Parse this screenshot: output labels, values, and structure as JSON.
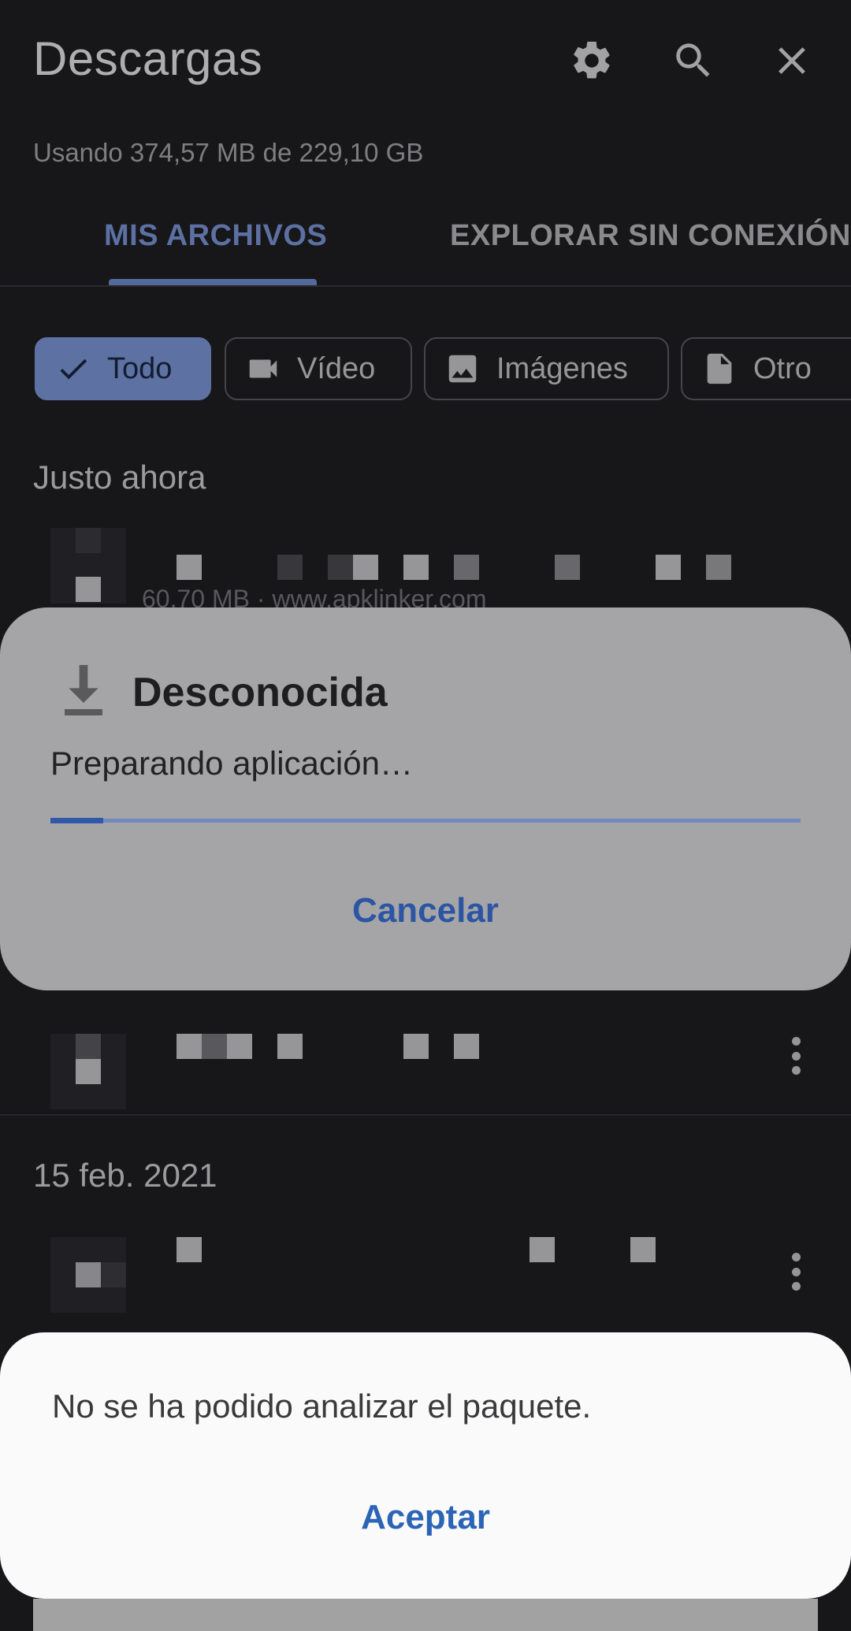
{
  "header": {
    "title": "Descargas",
    "usage": "Usando 374,57 MB de 229,10 GB",
    "icons": [
      "gear-icon",
      "search-icon",
      "close-icon"
    ]
  },
  "tabs": [
    {
      "label": "MIS ARCHIVOS",
      "selected": true
    },
    {
      "label": "EXPLORAR SIN CONEXIÓN",
      "selected": false
    }
  ],
  "chips": [
    {
      "label": "Todo",
      "icon": "check-icon",
      "selected": true
    },
    {
      "label": "Vídeo",
      "icon": "video-icon",
      "selected": false
    },
    {
      "label": "Imágenes",
      "icon": "image-icon",
      "selected": false
    },
    {
      "label": "Otro",
      "icon": "file-icon",
      "selected": false
    }
  ],
  "sections": [
    {
      "label": "Justo ahora"
    },
    {
      "label": "15 feb. 2021"
    }
  ],
  "list": {
    "item1_subtitle": "60,70 MB · www.apklinker.com"
  },
  "install_dialog": {
    "app_name": "Desconocida",
    "status": "Preparando aplicación…",
    "progress": 0.07,
    "cancel_label": "Cancelar"
  },
  "error_dialog": {
    "message": "No se ha podido analizar el paquete.",
    "ok_label": "Aceptar"
  },
  "colors": {
    "accent": "#7b96d8",
    "dialog_button": "#2c55a3",
    "background": "#1f1f23"
  }
}
